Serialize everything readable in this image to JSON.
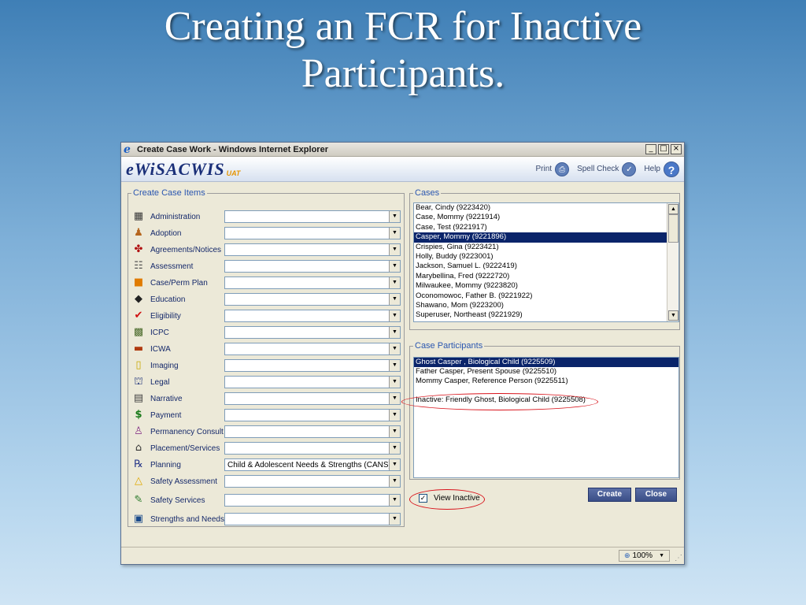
{
  "slide": {
    "title_line1": "Creating an FCR for Inactive",
    "title_line2": "Participants."
  },
  "window": {
    "title": "Create Case Work - Windows Internet Explorer",
    "minimize": "_",
    "maximize": "□",
    "close": "×"
  },
  "app": {
    "brand": "eWiSACWIS",
    "env": "UAT",
    "print_label": "Print",
    "spell_label": "Spell Check",
    "help_label": "Help"
  },
  "items": {
    "legend": "Create Case Items",
    "rows": [
      {
        "label": "Administration",
        "value": ""
      },
      {
        "label": "Adoption",
        "value": ""
      },
      {
        "label": "Agreements/Notices",
        "value": ""
      },
      {
        "label": "Assessment",
        "value": ""
      },
      {
        "label": "Case/Perm Plan",
        "value": ""
      },
      {
        "label": "Education",
        "value": ""
      },
      {
        "label": "Eligibility",
        "value": ""
      },
      {
        "label": "ICPC",
        "value": ""
      },
      {
        "label": "ICWA",
        "value": ""
      },
      {
        "label": "Imaging",
        "value": ""
      },
      {
        "label": "Legal",
        "value": ""
      },
      {
        "label": "Narrative",
        "value": ""
      },
      {
        "label": "Payment",
        "value": ""
      },
      {
        "label": "Permanency Consult",
        "value": ""
      },
      {
        "label": "Placement/Services",
        "value": ""
      },
      {
        "label": "Planning",
        "value": "Child & Adolescent Needs & Strengths (CANS)"
      },
      {
        "label": "Safety Assessment",
        "value": ""
      },
      {
        "label": "Safety Services",
        "value": ""
      },
      {
        "label": "Strengths and Needs",
        "value": ""
      }
    ]
  },
  "cases": {
    "legend": "Cases",
    "rows": [
      "Bear, Cindy (9223420)",
      "Case, Mommy (9221914)",
      "Case, Test (9221917)",
      "Casper, Mommy (9221896)",
      "Crispies, Gina (9223421)",
      "Holly, Buddy (9223001)",
      "Jackson, Samuel L. (9222419)",
      "Marybellina, Fred (9222720)",
      "Milwaukee, Mommy (9223820)",
      "Oconomowoc, Father B. (9221922)",
      "Shawano, Mom (9223200)",
      "Superuser, Northeast (9221929)"
    ],
    "selected_index": 3
  },
  "participants": {
    "legend": "Case Participants",
    "rows": [
      "Ghost Casper , Biological Child (9225509)",
      "Father Casper, Present Spouse (9225510)",
      "Mommy Casper, Reference Person (9225511)"
    ],
    "inactive": "Inactive: Friendly Ghost, Biological Child (9225508)"
  },
  "footer": {
    "view_inactive_label": "View Inactive",
    "view_inactive_checked": true,
    "create_label": "Create",
    "close_label": "Close"
  },
  "status": {
    "zoom": "100%"
  }
}
